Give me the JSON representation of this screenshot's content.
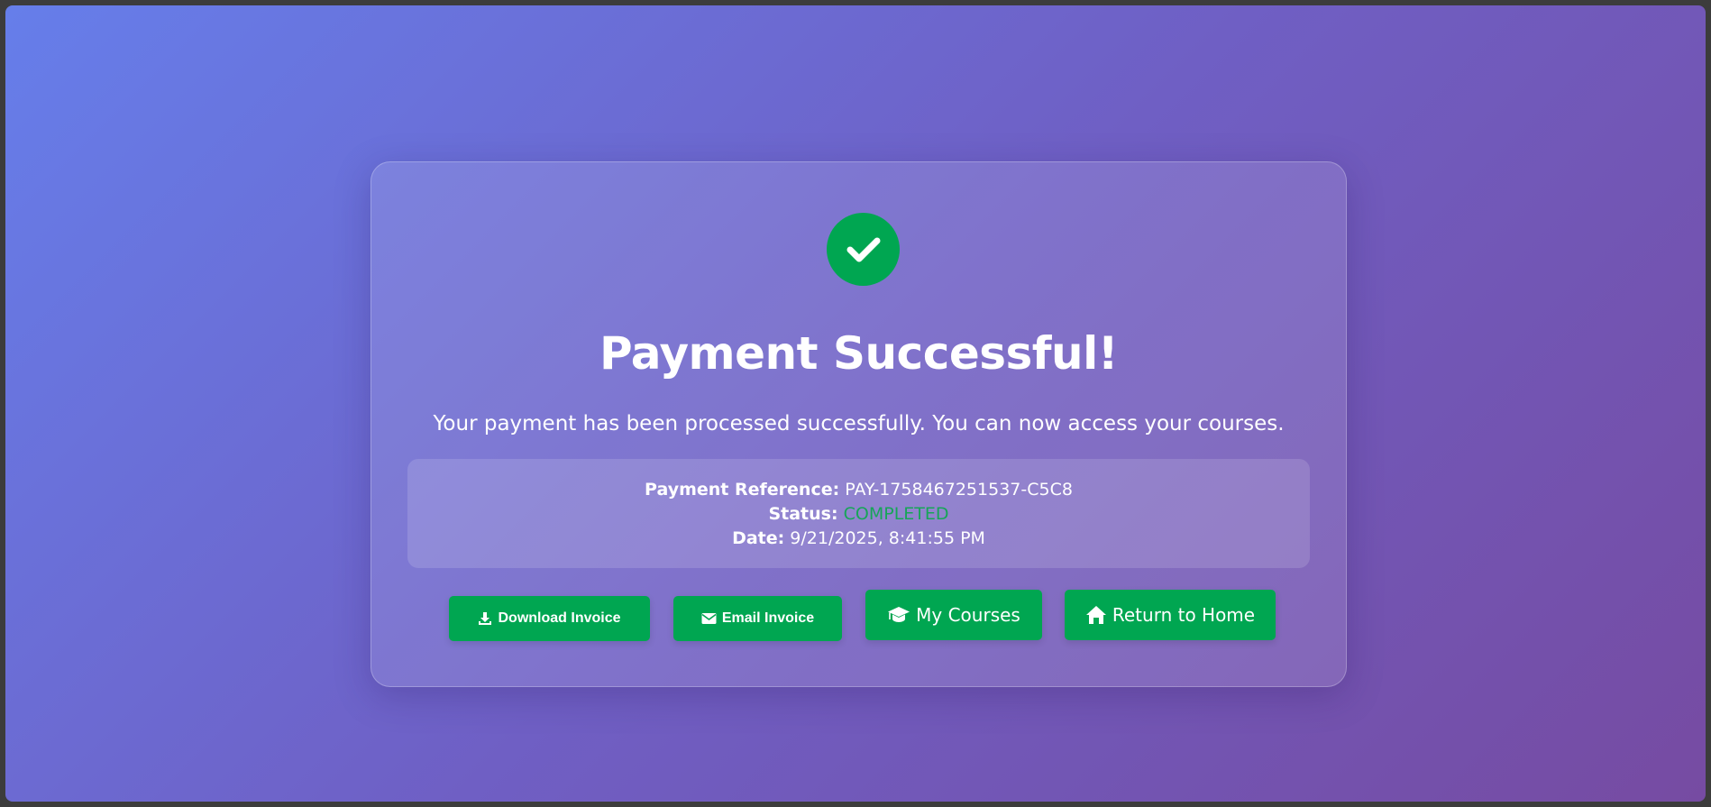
{
  "colors": {
    "accent_green": "#00a651",
    "status_green": "#17a558",
    "gradient_start": "#667eea",
    "gradient_end": "#764ba2"
  },
  "icons": {
    "success": "check-circle-icon",
    "download": "download-icon",
    "email": "envelope-icon",
    "courses": "graduation-cap-icon",
    "home": "home-icon"
  },
  "success": {
    "title": "Payment Successful!",
    "message": "Your payment has been processed successfully. You can now access your courses."
  },
  "details": {
    "reference_label": "Payment Reference:",
    "reference_value": "PAY-1758467251537-C5C8",
    "status_label": "Status:",
    "status_value": "COMPLETED",
    "date_label": "Date:",
    "date_value": "9/21/2025, 8:41:55 PM"
  },
  "actions": {
    "download_invoice": "Download Invoice",
    "email_invoice": "Email Invoice",
    "my_courses": "My Courses",
    "return_home": "Return to Home"
  }
}
